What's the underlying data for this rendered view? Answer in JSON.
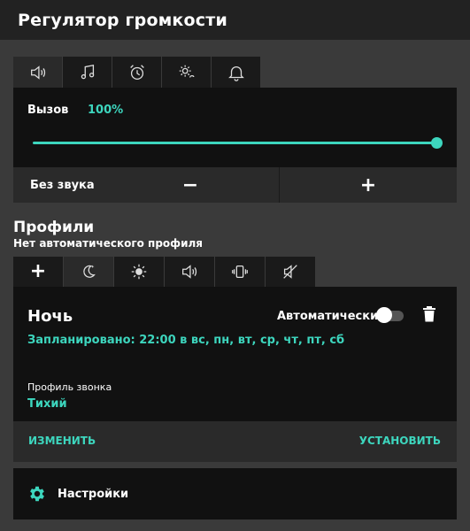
{
  "window": {
    "title": "Регулятор громкости"
  },
  "volume": {
    "tabs": [
      {
        "icon": "speaker-icon",
        "active": true
      },
      {
        "icon": "music-note-icon",
        "active": false
      },
      {
        "icon": "alarm-clock-icon",
        "active": false
      },
      {
        "icon": "system-gear-icon",
        "active": false
      },
      {
        "icon": "bell-icon",
        "active": false
      }
    ],
    "label": "Вызов",
    "value": "100%",
    "level": 1.0,
    "mute_label": "Без звука",
    "minus_label": "−",
    "plus_label": "+"
  },
  "profiles": {
    "heading": "Профили",
    "subheading": "Нет автоматического профиля",
    "tabs": [
      {
        "label": "+",
        "active": false
      },
      {
        "icon": "moon-icon",
        "active": true
      },
      {
        "icon": "sun-icon",
        "active": false
      },
      {
        "icon": "speaker-icon",
        "active": false
      },
      {
        "icon": "vibrate-icon",
        "active": false
      },
      {
        "icon": "muted-speaker-icon",
        "active": false
      }
    ],
    "current": {
      "name": "Ночь",
      "auto_label": "Автоматически",
      "auto_enabled": false,
      "schedule": "Запланировано: 22:00 в вс, пн, вт, ср, чт, пт, сб",
      "ring_label": "Профиль звонка",
      "ring_value": "Тихий"
    },
    "actions": {
      "edit": "ИЗМЕНИТЬ",
      "set": "УСТАНОВИТЬ"
    }
  },
  "settings": {
    "label": "Настройки"
  },
  "colors": {
    "accent": "#3dd6be",
    "panel": "#111111",
    "background": "#3a3a3a"
  }
}
